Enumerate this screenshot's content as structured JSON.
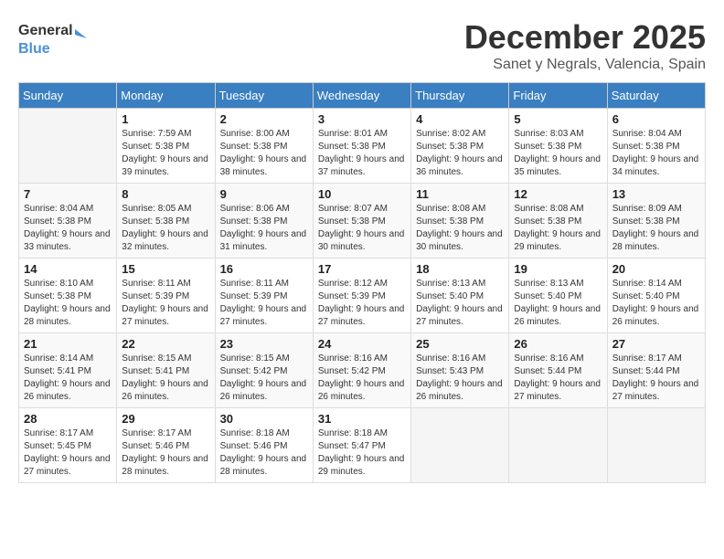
{
  "logo": {
    "text_general": "General",
    "text_blue": "Blue"
  },
  "title": {
    "month": "December 2025",
    "location": "Sanet y Negrals, Valencia, Spain"
  },
  "weekdays": [
    "Sunday",
    "Monday",
    "Tuesday",
    "Wednesday",
    "Thursday",
    "Friday",
    "Saturday"
  ],
  "weeks": [
    [
      {
        "day": "",
        "sunrise": "",
        "sunset": "",
        "daylight": ""
      },
      {
        "day": "1",
        "sunrise": "Sunrise: 7:59 AM",
        "sunset": "Sunset: 5:38 PM",
        "daylight": "Daylight: 9 hours and 39 minutes."
      },
      {
        "day": "2",
        "sunrise": "Sunrise: 8:00 AM",
        "sunset": "Sunset: 5:38 PM",
        "daylight": "Daylight: 9 hours and 38 minutes."
      },
      {
        "day": "3",
        "sunrise": "Sunrise: 8:01 AM",
        "sunset": "Sunset: 5:38 PM",
        "daylight": "Daylight: 9 hours and 37 minutes."
      },
      {
        "day": "4",
        "sunrise": "Sunrise: 8:02 AM",
        "sunset": "Sunset: 5:38 PM",
        "daylight": "Daylight: 9 hours and 36 minutes."
      },
      {
        "day": "5",
        "sunrise": "Sunrise: 8:03 AM",
        "sunset": "Sunset: 5:38 PM",
        "daylight": "Daylight: 9 hours and 35 minutes."
      },
      {
        "day": "6",
        "sunrise": "Sunrise: 8:04 AM",
        "sunset": "Sunset: 5:38 PM",
        "daylight": "Daylight: 9 hours and 34 minutes."
      }
    ],
    [
      {
        "day": "7",
        "sunrise": "Sunrise: 8:04 AM",
        "sunset": "Sunset: 5:38 PM",
        "daylight": "Daylight: 9 hours and 33 minutes."
      },
      {
        "day": "8",
        "sunrise": "Sunrise: 8:05 AM",
        "sunset": "Sunset: 5:38 PM",
        "daylight": "Daylight: 9 hours and 32 minutes."
      },
      {
        "day": "9",
        "sunrise": "Sunrise: 8:06 AM",
        "sunset": "Sunset: 5:38 PM",
        "daylight": "Daylight: 9 hours and 31 minutes."
      },
      {
        "day": "10",
        "sunrise": "Sunrise: 8:07 AM",
        "sunset": "Sunset: 5:38 PM",
        "daylight": "Daylight: 9 hours and 30 minutes."
      },
      {
        "day": "11",
        "sunrise": "Sunrise: 8:08 AM",
        "sunset": "Sunset: 5:38 PM",
        "daylight": "Daylight: 9 hours and 30 minutes."
      },
      {
        "day": "12",
        "sunrise": "Sunrise: 8:08 AM",
        "sunset": "Sunset: 5:38 PM",
        "daylight": "Daylight: 9 hours and 29 minutes."
      },
      {
        "day": "13",
        "sunrise": "Sunrise: 8:09 AM",
        "sunset": "Sunset: 5:38 PM",
        "daylight": "Daylight: 9 hours and 28 minutes."
      }
    ],
    [
      {
        "day": "14",
        "sunrise": "Sunrise: 8:10 AM",
        "sunset": "Sunset: 5:38 PM",
        "daylight": "Daylight: 9 hours and 28 minutes."
      },
      {
        "day": "15",
        "sunrise": "Sunrise: 8:11 AM",
        "sunset": "Sunset: 5:39 PM",
        "daylight": "Daylight: 9 hours and 27 minutes."
      },
      {
        "day": "16",
        "sunrise": "Sunrise: 8:11 AM",
        "sunset": "Sunset: 5:39 PM",
        "daylight": "Daylight: 9 hours and 27 minutes."
      },
      {
        "day": "17",
        "sunrise": "Sunrise: 8:12 AM",
        "sunset": "Sunset: 5:39 PM",
        "daylight": "Daylight: 9 hours and 27 minutes."
      },
      {
        "day": "18",
        "sunrise": "Sunrise: 8:13 AM",
        "sunset": "Sunset: 5:40 PM",
        "daylight": "Daylight: 9 hours and 27 minutes."
      },
      {
        "day": "19",
        "sunrise": "Sunrise: 8:13 AM",
        "sunset": "Sunset: 5:40 PM",
        "daylight": "Daylight: 9 hours and 26 minutes."
      },
      {
        "day": "20",
        "sunrise": "Sunrise: 8:14 AM",
        "sunset": "Sunset: 5:40 PM",
        "daylight": "Daylight: 9 hours and 26 minutes."
      }
    ],
    [
      {
        "day": "21",
        "sunrise": "Sunrise: 8:14 AM",
        "sunset": "Sunset: 5:41 PM",
        "daylight": "Daylight: 9 hours and 26 minutes."
      },
      {
        "day": "22",
        "sunrise": "Sunrise: 8:15 AM",
        "sunset": "Sunset: 5:41 PM",
        "daylight": "Daylight: 9 hours and 26 minutes."
      },
      {
        "day": "23",
        "sunrise": "Sunrise: 8:15 AM",
        "sunset": "Sunset: 5:42 PM",
        "daylight": "Daylight: 9 hours and 26 minutes."
      },
      {
        "day": "24",
        "sunrise": "Sunrise: 8:16 AM",
        "sunset": "Sunset: 5:42 PM",
        "daylight": "Daylight: 9 hours and 26 minutes."
      },
      {
        "day": "25",
        "sunrise": "Sunrise: 8:16 AM",
        "sunset": "Sunset: 5:43 PM",
        "daylight": "Daylight: 9 hours and 26 minutes."
      },
      {
        "day": "26",
        "sunrise": "Sunrise: 8:16 AM",
        "sunset": "Sunset: 5:44 PM",
        "daylight": "Daylight: 9 hours and 27 minutes."
      },
      {
        "day": "27",
        "sunrise": "Sunrise: 8:17 AM",
        "sunset": "Sunset: 5:44 PM",
        "daylight": "Daylight: 9 hours and 27 minutes."
      }
    ],
    [
      {
        "day": "28",
        "sunrise": "Sunrise: 8:17 AM",
        "sunset": "Sunset: 5:45 PM",
        "daylight": "Daylight: 9 hours and 27 minutes."
      },
      {
        "day": "29",
        "sunrise": "Sunrise: 8:17 AM",
        "sunset": "Sunset: 5:46 PM",
        "daylight": "Daylight: 9 hours and 28 minutes."
      },
      {
        "day": "30",
        "sunrise": "Sunrise: 8:18 AM",
        "sunset": "Sunset: 5:46 PM",
        "daylight": "Daylight: 9 hours and 28 minutes."
      },
      {
        "day": "31",
        "sunrise": "Sunrise: 8:18 AM",
        "sunset": "Sunset: 5:47 PM",
        "daylight": "Daylight: 9 hours and 29 minutes."
      },
      {
        "day": "",
        "sunrise": "",
        "sunset": "",
        "daylight": ""
      },
      {
        "day": "",
        "sunrise": "",
        "sunset": "",
        "daylight": ""
      },
      {
        "day": "",
        "sunrise": "",
        "sunset": "",
        "daylight": ""
      }
    ]
  ]
}
